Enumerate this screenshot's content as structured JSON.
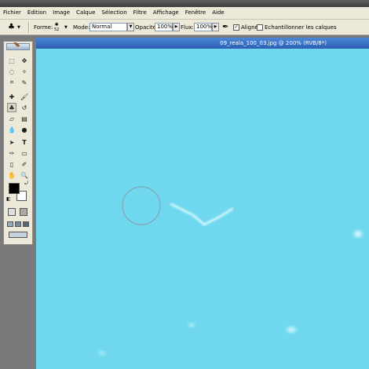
{
  "menu": [
    "Fichier",
    "Edition",
    "Image",
    "Calque",
    "Sélection",
    "Filtre",
    "Affichage",
    "Fenêtre",
    "Aide"
  ],
  "options": {
    "forme_label": "Forme:",
    "brush_size": "52",
    "mode_label": "Mode:",
    "mode_value": "Normal",
    "opacite_label": "Opacité:",
    "opacite_value": "100%",
    "flux_label": "Flux:",
    "flux_value": "100%",
    "aligne_label": "Aligné",
    "aligne_checked": true,
    "echantillonner_label": "Echantillonner les calques",
    "echantillonner_checked": false
  },
  "document": {
    "title": "09_reala_100_03.jpg @ 200% (RVB/8*)",
    "canvas_color": "#6fd8ee"
  },
  "colors": {
    "foreground": "#000000",
    "background": "#ffffff"
  }
}
